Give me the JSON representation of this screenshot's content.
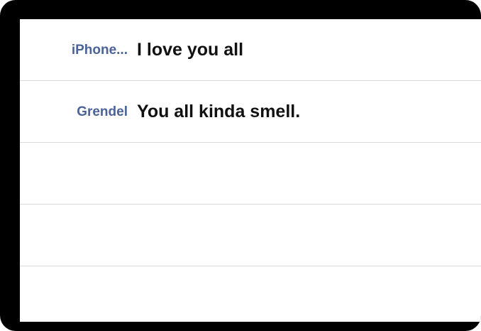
{
  "chat": {
    "messages": [
      {
        "sender": "iPhone...",
        "text": "I love you all"
      },
      {
        "sender": "Grendel",
        "text": "You all kinda smell."
      }
    ]
  },
  "colors": {
    "frame": "#000000",
    "background": "#ffffff",
    "sender": "#4b6396",
    "message": "#111111",
    "divider": "#d9d9d9"
  }
}
